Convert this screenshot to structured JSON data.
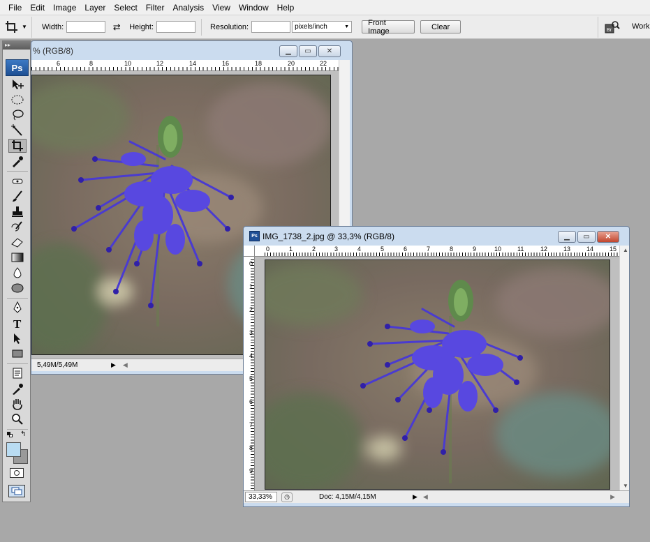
{
  "menu": [
    "File",
    "Edit",
    "Image",
    "Layer",
    "Select",
    "Filter",
    "Analysis",
    "View",
    "Window",
    "Help"
  ],
  "options": {
    "width_label": "Width:",
    "width_value": "",
    "height_label": "Height:",
    "height_value": "",
    "resolution_label": "Resolution:",
    "resolution_value": "",
    "resolution_unit": "pixels/inch",
    "front_image_label": "Front Image",
    "clear_label": "Clear",
    "workspace_label": "Work"
  },
  "tools": {
    "logo": "Ps",
    "items": [
      "move",
      "marquee",
      "lasso",
      "magic-wand",
      "crop",
      "eyedropper-slice",
      "spot-heal",
      "brush",
      "clone-stamp",
      "history-brush",
      "eraser",
      "gradient",
      "blur",
      "dodge",
      "pen",
      "type",
      "path-select",
      "shape",
      "notes",
      "eyedropper",
      "hand",
      "zoom"
    ],
    "active": "crop"
  },
  "doc1": {
    "title": "% (RGB/8)",
    "ruler_h": [
      "6",
      "8",
      "10",
      "12",
      "14",
      "16",
      "18",
      "20",
      "22"
    ],
    "status": "5,49M/5,49M"
  },
  "doc2": {
    "title": "IMG_1738_2.jpg @ 33,3% (RGB/8)",
    "ruler_h": [
      "0",
      "1",
      "2",
      "3",
      "4",
      "5",
      "6",
      "7",
      "8",
      "9",
      "10",
      "11",
      "12",
      "13",
      "14",
      "15"
    ],
    "ruler_v": [
      "0",
      "1",
      "2",
      "3",
      "4",
      "5",
      "6",
      "7",
      "8",
      "9"
    ],
    "zoom": "33,33%",
    "status": "Doc: 4,15M/4,15M"
  },
  "colors": {
    "foreground": "#b9dcf2",
    "background": "#9a9a9a"
  }
}
